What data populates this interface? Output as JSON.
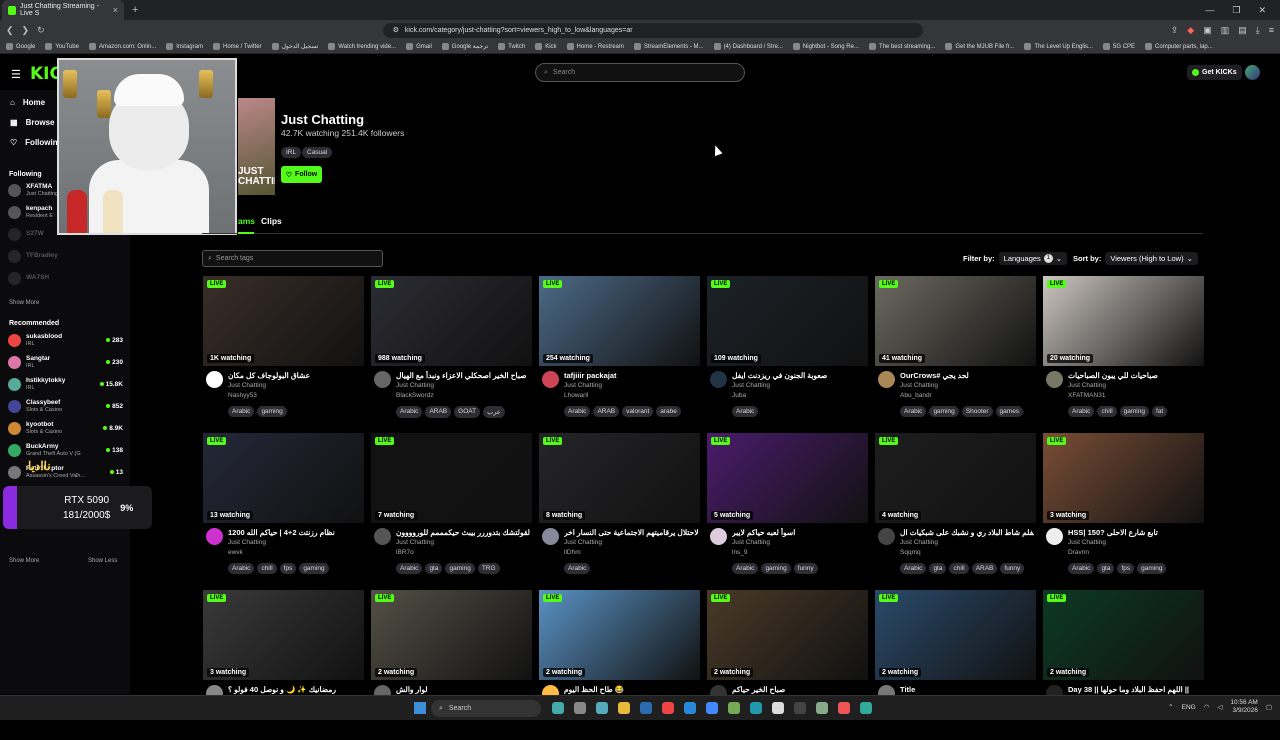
{
  "browser": {
    "tab_title": "Just Chatting Streaming - Live S",
    "url": "kick.com/category/just-chatting?sort=viewers_high_to_low&languages=ar",
    "bookmarks": [
      "Google",
      "YouTube",
      "Amazon.com: Onlin...",
      "Instagram",
      "Home / Twitter",
      "تسجيل الدخول",
      "Watch trending vide...",
      "Gmail",
      "Google ترجمة",
      "Twitch",
      "Kick",
      "Home - Restream",
      "StreamElements - M...",
      "(4) Dashboard / Stre...",
      "Nightbot - Song Re...",
      "The best streaming...",
      "Get the MJUB File fr...",
      "The Level Up Englis...",
      "5G CPE",
      "Computer parts, lap..."
    ]
  },
  "header": {
    "logo": "KICK",
    "search_placeholder": "Search",
    "getkicks_label": "Get KICKs"
  },
  "sidebar": {
    "nav": [
      "Home",
      "Browse",
      "Following"
    ],
    "following_title": "Following",
    "following": [
      {
        "name": "XFATMA",
        "cat": "Just Chatting",
        "online": true
      },
      {
        "name": "kenpach",
        "cat": "Resident E",
        "online": true
      },
      {
        "name": "S27W",
        "online": false
      },
      {
        "name": "TFBradley",
        "online": false
      },
      {
        "name": "WA7SH",
        "online": false
      }
    ],
    "show_more": "Show More",
    "recommended_title": "Recommended",
    "recommended": [
      {
        "name": "sukasblood",
        "cat": "IRL",
        "viewers": "283"
      },
      {
        "name": "Sangtar",
        "cat": "IRL",
        "viewers": "230"
      },
      {
        "name": "hstikkytokky",
        "cat": "IRL",
        "viewers": "15.8K"
      },
      {
        "name": "Classybeef",
        "cat": "Slots & Casino",
        "viewers": "852"
      },
      {
        "name": "kyootbot",
        "cat": "Slots & Casino",
        "viewers": "8.9K"
      },
      {
        "name": "BuckArmy",
        "cat": "Grand Theft Auto V (G",
        "viewers": "138"
      },
      {
        "name": "RetroRaptor",
        "cat": "Assassin's Creed Valh...",
        "viewers": "13"
      },
      {
        "name": "TJR",
        "cat": "Just Chatting",
        "viewers": "7.4K"
      }
    ],
    "show_more2": "Show More",
    "show_less": "Show Less"
  },
  "overlay": {
    "gpu_name": "RTX 5090",
    "gpu_price": "181/2000$",
    "gpu_pct": "9%",
    "arabic_tag": "نااديا"
  },
  "category": {
    "art_text": "JUST CHATTING",
    "title": "Just Chatting",
    "watching": "42.7K watching",
    "followers": "251.4K followers",
    "tags": [
      "IRL",
      "Casual"
    ],
    "follow_label": "Follow",
    "tab_streams": "ams",
    "tab_clips": "Clips"
  },
  "filters": {
    "search_tags_placeholder": "Search tags",
    "filter_by": "Filter by:",
    "languages": "Languages",
    "languages_count": "1",
    "sort_by": "Sort by:",
    "sort_value": "Viewers (High to Low)"
  },
  "live_label": "LIVE",
  "cards": [
    {
      "watching": "1K watching",
      "title": "عشاق البولوجاف كل مكان",
      "cat": "Just Chatting",
      "user": "Nashyy53",
      "tags": [
        "Arabic",
        "gaming"
      ],
      "bg": "#3a2e28",
      "av": "#fff"
    },
    {
      "watching": "988 watching",
      "title": "صباح الخير اصحكلي الاعزاء ونبدأ مع الهيال",
      "cat": "Just Chatting",
      "user": "BlackSwordz",
      "tags": [
        "Arabic",
        "ARAB",
        "GOAT",
        "عرب"
      ],
      "bg": "#2c2c34",
      "av": "#666"
    },
    {
      "watching": "254 watching",
      "title": "tafjiiir packajat",
      "cat": "Just Chatting",
      "user": "Lhowarll",
      "tags": [
        "Arabic",
        "ARAB",
        "valorant",
        "arabe"
      ],
      "bg": "#4c6a88",
      "av": "#c45"
    },
    {
      "watching": "109 watching",
      "title": "صعوبة الجنون في ريزدنت ايفل",
      "cat": "Just Chatting",
      "user": "Juba",
      "tags": [
        "Arabic"
      ],
      "bg": "#1c2228",
      "av": "#234"
    },
    {
      "watching": "41 watching",
      "title": "OurCrows# لحد يجي",
      "cat": "Just Chatting",
      "user": "Abu_bandr",
      "tags": [
        "Arabic",
        "gaming",
        "Shooter",
        "games"
      ],
      "bg": "#6c6a60",
      "av": "#a85"
    },
    {
      "watching": "20 watching",
      "title": "صباحيات للي يبون الصباحيات",
      "cat": "Just Chatting",
      "user": "XFATMAN31",
      "tags": [
        "Arabic",
        "chill",
        "gaming",
        "fat"
      ],
      "bg": "#ccc6c0",
      "av": "#776"
    },
    {
      "watching": "13 watching",
      "title": "نظام رزنتت 2+4 | حياكم الله 1200",
      "cat": "Just Chatting",
      "user": "ewvk",
      "tags": [
        "Arabic",
        "chill",
        "fps",
        "gaming"
      ],
      "bg": "#242838",
      "av": "#c3c"
    },
    {
      "watching": "7 watching",
      "title": "القولتشك بتدوررر بيبث حيكمممم للوروووون",
      "cat": "Just Chatting",
      "user": "lBR7o",
      "tags": [
        "Arabic",
        "gta",
        "gaming",
        "TRG"
      ],
      "bg": "#121212",
      "av": "#555"
    },
    {
      "watching": "8 watching",
      "title": "الاحتلال يرقاميتهم الاجتماعية حتى النسار اخر",
      "cat": "Just Chatting",
      "user": "llDhm",
      "tags": [
        "Arabic"
      ],
      "bg": "#252528",
      "av": "#889"
    },
    {
      "watching": "5 watching",
      "title": "اسوأ لعبه حياكم لايبر",
      "cat": "Just Chatting",
      "user": "lns_9",
      "tags": [
        "Arabic",
        "gaming",
        "funny"
      ],
      "bg": "#4b1c6c",
      "av": "#dcd"
    },
    {
      "watching": "4 watching",
      "title": "الفلم شاط البلاد ري و نشبك على شبكيات ال ric",
      "cat": "Just Chatting",
      "user": "Sqqmq",
      "tags": [
        "Arabic",
        "gta",
        "chill",
        "ARAB",
        "funny"
      ],
      "bg": "#1e1e1e",
      "av": "#444"
    },
    {
      "watching": "3 watching",
      "title": "HSS| 150? تابع شارع الاحلى",
      "cat": "Just Chatting",
      "user": "Dravnn",
      "tags": [
        "Arabic",
        "gta",
        "fps",
        "gaming"
      ],
      "bg": "#7a4e36",
      "av": "#eee"
    },
    {
      "watching": "3 watching",
      "title": "رمضانيك ✨ 🌙 و نوصل 40 فولو ؟",
      "cat": "",
      "user": "",
      "tags": [],
      "bg": "#3a3a3a",
      "av": "#888"
    },
    {
      "watching": "2 watching",
      "title": "لوار والش",
      "cat": "",
      "user": "",
      "tags": [],
      "bg": "#545046",
      "av": "#666"
    },
    {
      "watching": "2 watching",
      "title": "طاح الحظ اليوم 😂",
      "cat": "",
      "user": "",
      "tags": [],
      "bg": "#5a92c4",
      "av": "#fb4"
    },
    {
      "watching": "2 watching",
      "title": "صباح الخير حياكم",
      "cat": "",
      "user": "",
      "tags": [],
      "bg": "#4a3a28",
      "av": "#333"
    },
    {
      "watching": "2 watching",
      "title": "Title",
      "cat": "",
      "user": "",
      "tags": [],
      "bg": "#2a4a6a",
      "av": "#777"
    },
    {
      "watching": "2 watching",
      "title": "Day 38 || اللهم احفظ البلاد وما حولها ||",
      "cat": "",
      "user": "",
      "tags": [],
      "bg": "#0c3a24",
      "av": "#222"
    }
  ],
  "taskbar": {
    "search_placeholder": "Search",
    "lang": "ENG",
    "time": "10:56 AM",
    "date": "3/9/2026"
  }
}
